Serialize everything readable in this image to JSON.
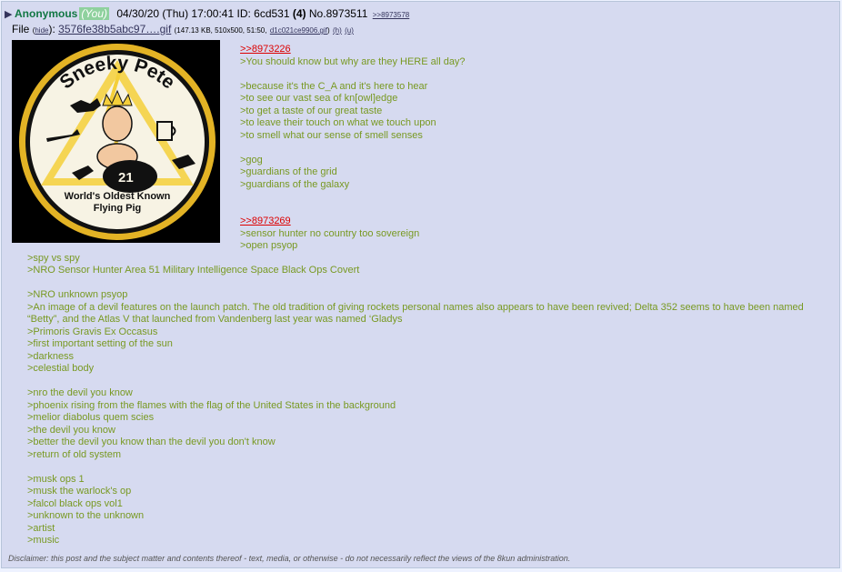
{
  "post": {
    "name": "Anonymous",
    "you_badge": "(You)",
    "datetime": "04/30/20 (Thu) 17:00:41",
    "id_label": "ID: 6cd531",
    "reply_count": "(4)",
    "post_no": "No.8973511",
    "backlink": ">>8973578"
  },
  "file": {
    "label": "File",
    "hide_open": "(",
    "hide": "hide",
    "hide_close": "):",
    "filename": "3576fe38b5abc97….gif",
    "details": "(147.13 KB, 510x500, 51:50,",
    "original_name": "d1c021ce9906.gif",
    "details_close": ")",
    "link_h": "(h)",
    "link_u": "(u)"
  },
  "patch": {
    "title_text": "Sneeky Pete",
    "number": "21",
    "bottom_line1": "World's Oldest Known",
    "bottom_line2": "Flying Pig",
    "colors": {
      "rim": "#e3b325",
      "field": "#f7f3e4",
      "lightning": "#f4cf3a",
      "ink": "#111111"
    }
  },
  "body_lines": [
    {
      "text": ">>8973226",
      "kind": "link",
      "indent": true
    },
    {
      "text": ">You should know but why are they HERE all day?",
      "kind": "quote",
      "indent": true
    },
    {
      "text": "",
      "kind": "blank",
      "indent": true
    },
    {
      "text": ">because it's the C_A and it's here to hear",
      "kind": "quote",
      "indent": true
    },
    {
      "text": ">to see our vast sea of kn[owl]edge",
      "kind": "quote",
      "indent": true
    },
    {
      "text": ">to get a taste of our great taste",
      "kind": "quote",
      "indent": true
    },
    {
      "text": ">to leave their touch on what we touch upon",
      "kind": "quote",
      "indent": true
    },
    {
      "text": ">to smell what our sense of smell senses",
      "kind": "quote",
      "indent": true
    },
    {
      "text": "",
      "kind": "blank",
      "indent": true
    },
    {
      "text": ">gog",
      "kind": "quote",
      "indent": true
    },
    {
      "text": ">guardians of the grid",
      "kind": "quote",
      "indent": true
    },
    {
      "text": ">guardians of the galaxy",
      "kind": "quote",
      "indent": true
    },
    {
      "text": "",
      "kind": "blank",
      "indent": true
    },
    {
      "text": "",
      "kind": "blank",
      "indent": true
    },
    {
      "text": ">>8973269",
      "kind": "link",
      "indent": true
    },
    {
      "text": ">sensor hunter no country too sovereign",
      "kind": "quote",
      "indent": true
    },
    {
      "text": ">open psyop",
      "kind": "quote",
      "indent": true
    },
    {
      "text": ">spy vs spy",
      "kind": "quote",
      "indent": false
    },
    {
      "text": ">NRO Sensor Hunter Area 51 Military Intelligence Space Black Ops Covert",
      "kind": "quote",
      "indent": false
    },
    {
      "text": "",
      "kind": "blank",
      "indent": false
    },
    {
      "text": ">NRO unknown psyop",
      "kind": "quote",
      "indent": false
    },
    {
      "text": ">An image of a devil features on the launch patch. The old tradition of giving rockets personal names also appears to have been revived; Delta 352 seems to have been named “Betty”, and the Atlas V that launched from Vandenberg last year was named ‘Gladys",
      "kind": "quote",
      "indent": false
    },
    {
      "text": ">Primoris Gravis Ex Occasus",
      "kind": "quote",
      "indent": false
    },
    {
      "text": ">first important setting of the sun",
      "kind": "quote",
      "indent": false
    },
    {
      "text": ">darkness",
      "kind": "quote",
      "indent": false
    },
    {
      "text": ">celestial body",
      "kind": "quote",
      "indent": false
    },
    {
      "text": "",
      "kind": "blank",
      "indent": false
    },
    {
      "text": ">nro the devil you know",
      "kind": "quote",
      "indent": false
    },
    {
      "text": ">phoenix rising from the flames with the flag of the United States in the background",
      "kind": "quote",
      "indent": false
    },
    {
      "text": ">melior diabolus quem scies",
      "kind": "quote",
      "indent": false
    },
    {
      "text": ">the devil you know",
      "kind": "quote",
      "indent": false
    },
    {
      "text": ">better the devil you know than the devil you don't know",
      "kind": "quote",
      "indent": false
    },
    {
      "text": ">return of old system",
      "kind": "quote",
      "indent": false
    },
    {
      "text": "",
      "kind": "blank",
      "indent": false
    },
    {
      "text": ">musk ops 1",
      "kind": "quote",
      "indent": false
    },
    {
      "text": ">musk the warlock's op",
      "kind": "quote",
      "indent": false
    },
    {
      "text": ">falcol black ops vol1",
      "kind": "quote",
      "indent": false
    },
    {
      "text": ">unknown to the unknown",
      "kind": "quote",
      "indent": false
    },
    {
      "text": ">artist",
      "kind": "quote",
      "indent": false
    },
    {
      "text": ">music",
      "kind": "quote",
      "indent": false
    }
  ],
  "disclaimer": "Disclaimer: this post and the subject matter and contents thereof - text, media, or otherwise - do not necessarily reflect the views of the 8kun administration."
}
